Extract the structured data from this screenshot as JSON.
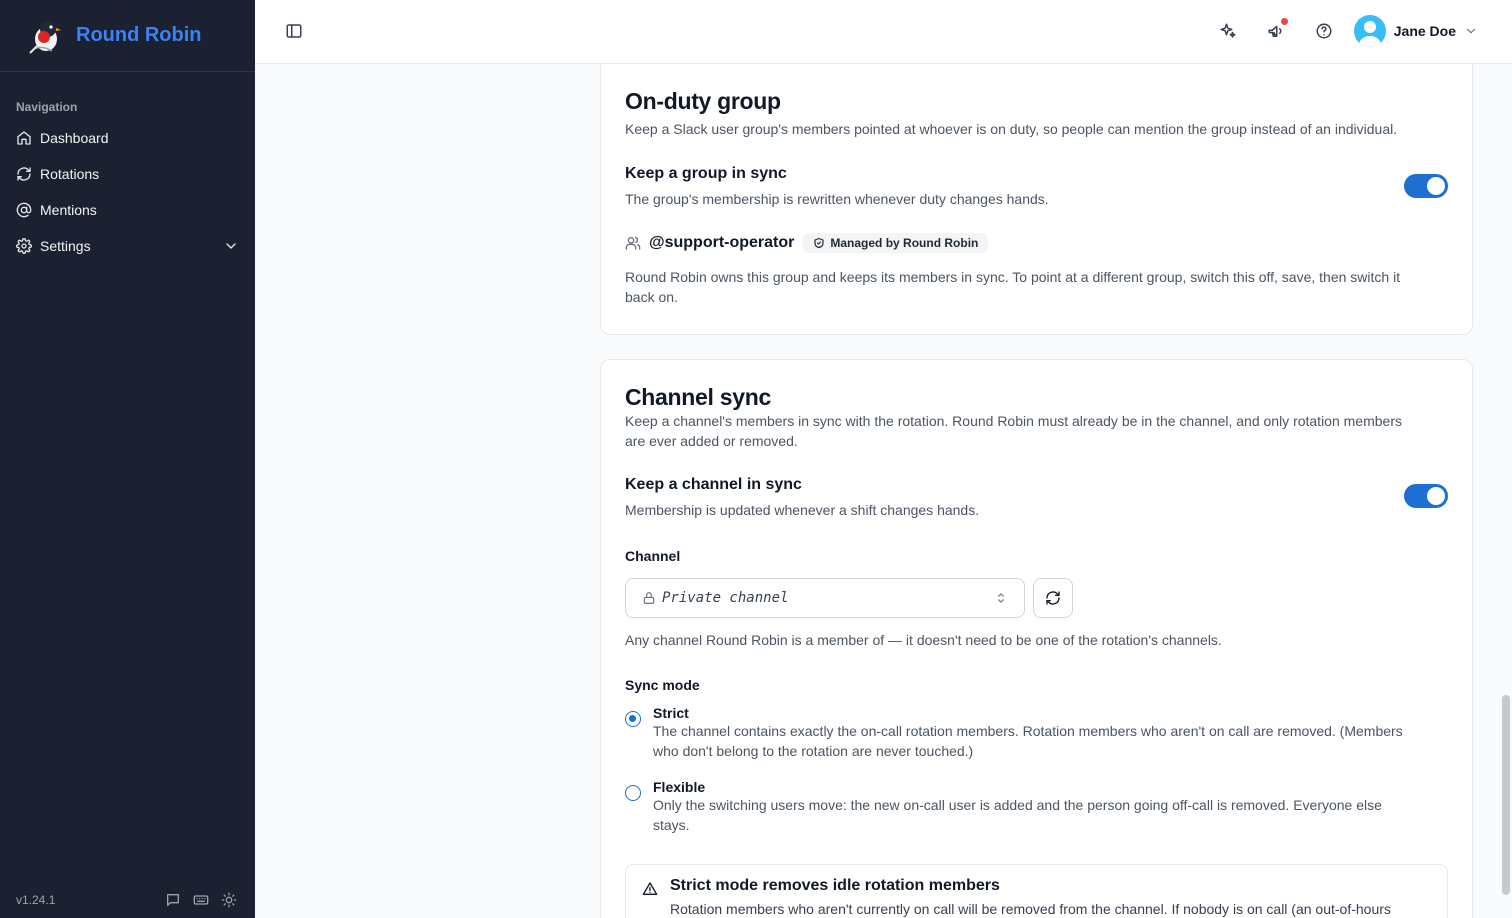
{
  "app": {
    "name": "Round Robin",
    "version": "v1.24.1"
  },
  "sidebar": {
    "heading": "Navigation",
    "items": [
      {
        "label": "Dashboard",
        "icon": "home-icon"
      },
      {
        "label": "Rotations",
        "icon": "refresh-icon"
      },
      {
        "label": "Mentions",
        "icon": "at-icon"
      },
      {
        "label": "Settings",
        "icon": "gear-icon"
      }
    ]
  },
  "header": {
    "user_name": "Jane Doe"
  },
  "on_duty": {
    "title": "On-duty group",
    "description": "Keep a Slack user group's members pointed at whoever is on duty, so people can mention the group instead of an individual.",
    "sync_title": "Keep a group in sync",
    "sync_desc": "The group's membership is rewritten whenever duty changes hands.",
    "sync_enabled": true,
    "group_name": "@support-operator",
    "badge": "Managed by Round Robin",
    "note_line1": "Round Robin owns this group and keeps its members in sync. To point at a different group, switch this off, save, then switch it",
    "note_line2": "back on."
  },
  "channel_sync": {
    "title": "Channel sync",
    "description_line1": "Keep a channel's members in sync with the rotation. Round Robin must already be in the channel, and only rotation members",
    "description_line2": "are ever added or removed.",
    "sync_title": "Keep a channel in sync",
    "sync_desc": "Membership is updated whenever a shift changes hands.",
    "sync_enabled": true,
    "channel_label": "Channel",
    "channel_value": "Private channel",
    "channel_help": "Any channel Round Robin is a member of — it doesn't need to be one of the rotation's channels.",
    "sync_mode_label": "Sync mode",
    "modes": [
      {
        "title": "Strict",
        "line1": "The channel contains exactly the on-call rotation members. Rotation members who aren't on call are removed. (Members",
        "line2": "who don't belong to the rotation are never touched.)",
        "selected": true
      },
      {
        "title": "Flexible",
        "line1": "Only the switching users move: the new on-call user is added and the person going off-call is removed. Everyone else",
        "line2": "stays.",
        "selected": false
      }
    ],
    "alert_title": "Strict mode removes idle rotation members",
    "alert_desc": "Rotation members who aren't currently on call will be removed from the channel. If nobody is on call (an out-of-hours"
  },
  "colors": {
    "accent": "#1d6fd1",
    "sidebar_bg": "#1b2130",
    "brand": "#3b82f6",
    "notification": "#ef4444"
  }
}
